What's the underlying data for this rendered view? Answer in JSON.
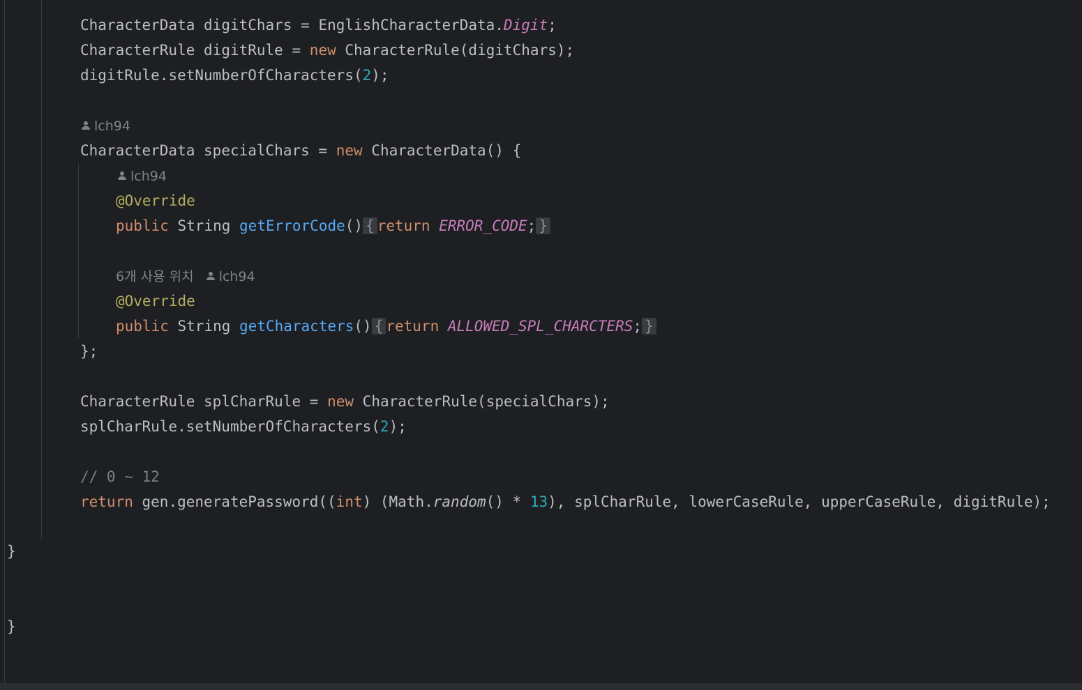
{
  "code": {
    "line1": {
      "type": "CharacterData",
      "var": "digitChars",
      "eq": "=",
      "cls": "EnglishCharacterData",
      "field": "Digit"
    },
    "line2": {
      "type": "CharacterRule",
      "var": "digitRule",
      "eq": "=",
      "kw_new": "new",
      "ctor": "CharacterRule",
      "arg": "digitChars"
    },
    "line3": {
      "target": "digitRule",
      "method": "setNumberOfCharacters",
      "num": "2"
    },
    "hint1": {
      "author": "lch94"
    },
    "line4": {
      "type": "CharacterData",
      "var": "specialChars",
      "eq": "=",
      "kw_new": "new",
      "ctor": "CharacterData"
    },
    "hint2": {
      "author": "lch94"
    },
    "line5": {
      "annotation": "@Override"
    },
    "line6": {
      "kw_public": "public",
      "type": "String",
      "method": "getErrorCode",
      "kw_return": "return",
      "const": "ERROR_CODE"
    },
    "hint3": {
      "usages": "6개 사용 위치",
      "author": "lch94"
    },
    "line7": {
      "annotation": "@Override"
    },
    "line8": {
      "kw_public": "public",
      "type": "String",
      "method": "getCharacters",
      "kw_return": "return",
      "const": "ALLOWED_SPL_CHARCTERS"
    },
    "line9": {
      "text": "};"
    },
    "line10": {
      "type": "CharacterRule",
      "var": "splCharRule",
      "eq": "=",
      "kw_new": "new",
      "ctor": "CharacterRule",
      "arg": "specialChars"
    },
    "line11": {
      "target": "splCharRule",
      "method": "setNumberOfCharacters",
      "num": "2"
    },
    "line12": {
      "comment": "// 0 ~ 12"
    },
    "line13": {
      "kw_return": "return",
      "call": "gen.generatePassword((",
      "kw_int": "int",
      "mid": ") (Math.",
      "static_method": "random",
      "after_static": "() * ",
      "num": "13",
      "rest": "), splCharRule, lowerCaseRule, upperCaseRule, digitRule);"
    },
    "brace_close_1": "}",
    "brace_close_2": "}"
  },
  "colors": {
    "background": "#1e1f22",
    "text": "#bcbec4",
    "keyword": "#cf8e6d",
    "number": "#2aacb8",
    "function": "#56a8f5",
    "annotation": "#b3ae60",
    "constant": "#c77dbb",
    "comment": "#7a7e85",
    "hint": "#808388"
  },
  "icons": {
    "author": "person-icon"
  }
}
